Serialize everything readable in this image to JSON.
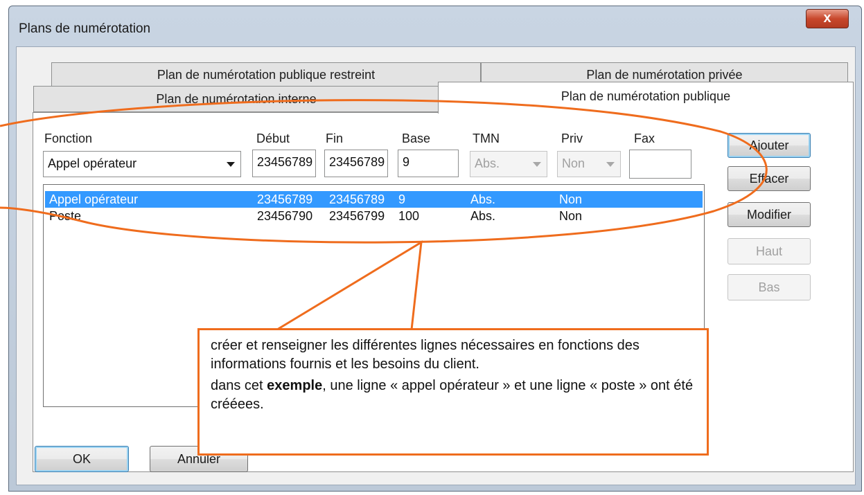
{
  "window": {
    "title": "Plans de numérotation",
    "close_label": "x"
  },
  "tabs": {
    "back": [
      "Plan de numérotation publique restreint",
      "Plan de numérotation privée"
    ],
    "front": [
      "Plan de numérotation interne",
      "Plan de numérotation publique"
    ]
  },
  "headers": {
    "fonction": "Fonction",
    "debut": "Début",
    "fin": "Fin",
    "base": "Base",
    "tmn": "TMN",
    "priv": "Priv",
    "fax": "Fax"
  },
  "inputs": {
    "fonction_selected": "Appel opérateur",
    "debut": "23456789",
    "fin": "23456789",
    "base": "9",
    "tmn_selected": "Abs.",
    "priv_selected": "Non",
    "fax": ""
  },
  "list_rows": [
    {
      "fonction": "Appel opérateur",
      "debut": "23456789",
      "fin": "23456789",
      "base": "9",
      "tmn": "Abs.",
      "priv": "Non"
    },
    {
      "fonction": "Poste",
      "debut": "23456790",
      "fin": "23456799",
      "base": "100",
      "tmn": "Abs.",
      "priv": "Non"
    }
  ],
  "buttons": {
    "ajouter": "Ajouter",
    "effacer": "Effacer",
    "modifier": "Modifier",
    "haut": "Haut",
    "bas": "Bas",
    "ok": "OK",
    "annuler": "Annuler"
  },
  "callout": {
    "line1": "créer et renseigner les différentes lignes nécessaires en fonctions des informations fournis et les besoins du client.",
    "line2_before": "dans cet ",
    "line2_bold": "exemple",
    "line2_after": ", une ligne « appel opérateur » et une ligne « poste » ont été crééees."
  },
  "colors": {
    "annotation": "#ef6c1d",
    "selection": "#3399ff"
  }
}
